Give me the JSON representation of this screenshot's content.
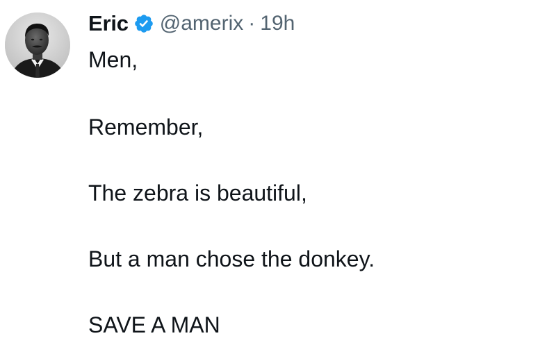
{
  "tweet": {
    "author": {
      "display_name": "Eric",
      "handle": "@amerix",
      "verified": true,
      "verified_badge_color": "#1d9bf0",
      "avatar_icon": "profile-photo-avatar"
    },
    "separator": "·",
    "time": "19h",
    "lines": [
      "Men,",
      "Remember,",
      "The zebra is beautiful,",
      "But a man chose the donkey.",
      "SAVE A MAN"
    ]
  }
}
